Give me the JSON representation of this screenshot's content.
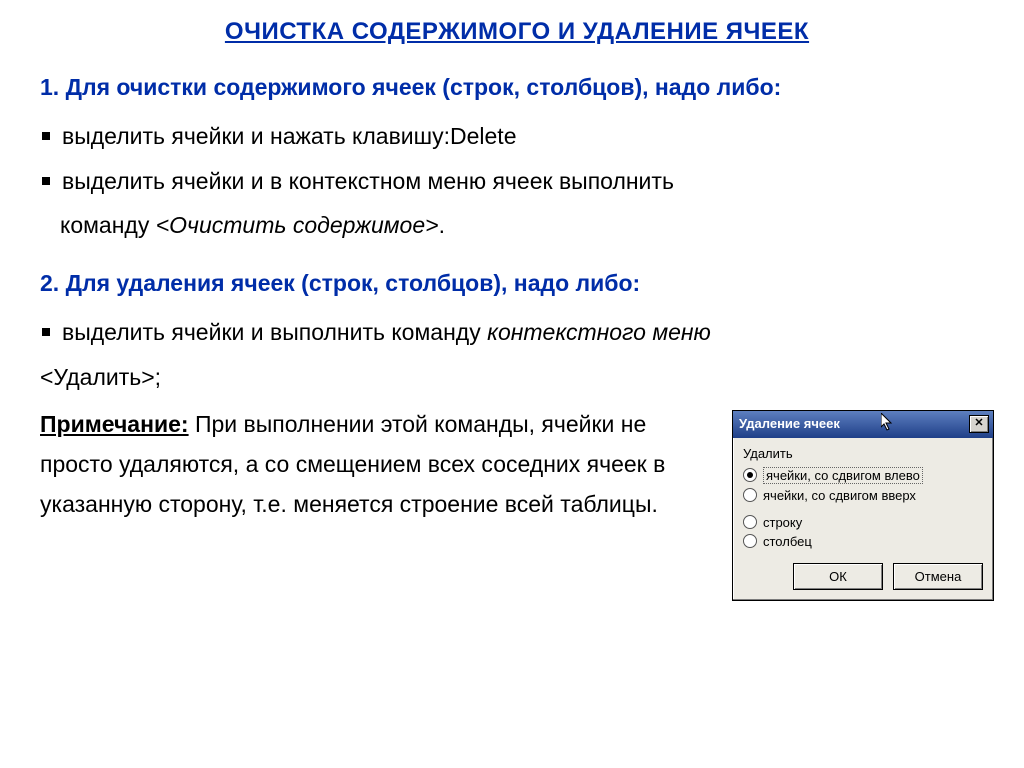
{
  "title": "ОЧИСТКА СОДЕРЖИМОГО И УДАЛЕНИЕ ЯЧЕЕК",
  "section1_head": "1. Для очистки содержимого ячеек (строк, столбцов), надо либо:",
  "section1_items": {
    "a": "выделить ячейки и нажать клавишу:Delete",
    "b_pre": "выделить ячейки и в контекстном меню ячеек выполнить",
    "b_cmd1": "команду ",
    "b_cmd2": "<Очистить содержимое>",
    "b_cmd3": "."
  },
  "section2_head": "2.  Для удаления ячеек (строк, столбцов), надо либо:",
  "section2_item_pre": "выделить ячейки и выполнить команду ",
  "section2_item_ital": "контекстного меню",
  "section2_item_tail_line": "<Удалить>;",
  "note_label": "Примечание:",
  "note_text": " При выполнении этой команды, ячейки не просто удаляются, а со смещением всех соседних ячеек в указанную сторону, т.е. меняется строение всей таблицы.",
  "dialog": {
    "title": "Удаление ячеек",
    "close": "✕",
    "label": "Удалить",
    "options": {
      "o1": "ячейки, со сдвигом влево",
      "o2": "ячейки, со сдвигом вверх",
      "o3": "строку",
      "o4": "столбец"
    },
    "ok": "ОК",
    "cancel": "Отмена"
  }
}
